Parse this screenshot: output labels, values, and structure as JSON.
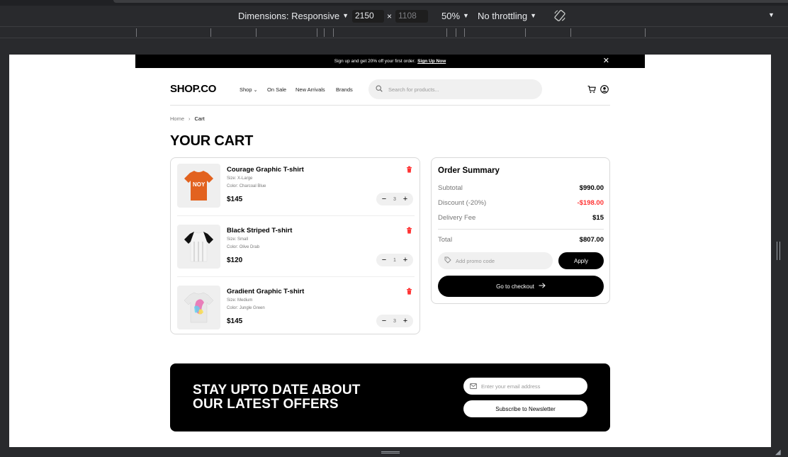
{
  "devtools": {
    "dimensions_label": "Dimensions: Responsive",
    "width_value": "2150",
    "times": "×",
    "height_value": "1108",
    "zoom": "50%",
    "throttling": "No throttling"
  },
  "promo": {
    "text": "Sign up and get 20% off your first order.",
    "link": "Sign Up Now"
  },
  "nav": {
    "logo": "SHOP.CO",
    "links": [
      "Shop",
      "On Sale",
      "New Arrivals",
      "Brands"
    ],
    "search_placeholder": "Search for products..."
  },
  "breadcrumb": [
    "Home",
    "Cart"
  ],
  "page_title": "YOUR CART",
  "cart": {
    "size_label": "Size:",
    "color_label": "Color:",
    "items": [
      {
        "name": "Courage Graphic T-shirt",
        "size": "X-Large",
        "color": "Charcoal Blue",
        "price": "$145",
        "qty": "3"
      },
      {
        "name": "Black Striped T-shirt",
        "size": "Small",
        "color": "Olive Drab",
        "price": "$120",
        "qty": "1"
      },
      {
        "name": "Gradient Graphic T-shirt",
        "size": "Medium",
        "color": "Jungle Green",
        "price": "$145",
        "qty": "3"
      }
    ]
  },
  "summary": {
    "title": "Order Summary",
    "subtotal_label": "Subtotal",
    "subtotal": "$990.00",
    "discount_label": "Discount (-20%)",
    "discount": "-$198.00",
    "delivery_label": "Delivery Fee",
    "delivery": "$15",
    "total_label": "Total",
    "total": "$807.00",
    "promo_placeholder": "Add promo code",
    "apply_label": "Apply",
    "checkout_label": "Go to checkout"
  },
  "newsletter": {
    "title_line1": "STAY UPTO DATE ABOUT",
    "title_line2": "OUR LATEST OFFERS",
    "email_placeholder": "Enter your email address",
    "subscribe_label": "Subscribe to Newsletter"
  },
  "colors": {
    "accent": "#000000",
    "discount": "#ff3333",
    "delete": "#ff3333",
    "surface": "#f0f0f0"
  }
}
